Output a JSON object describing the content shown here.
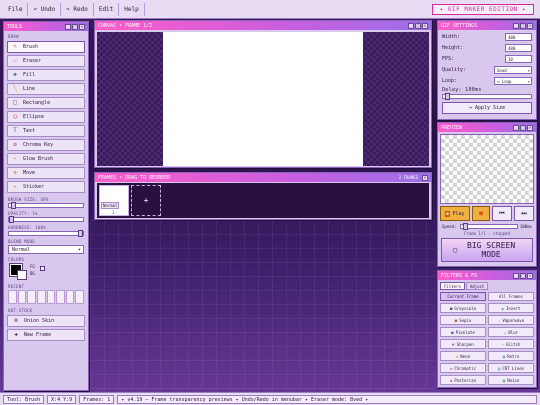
{
  "menu": {
    "file": "File",
    "undo": "↶ Undo",
    "redo": "↷ Redo",
    "edit": "Edit",
    "help": "Help",
    "brand": "✦ GIF MAKER EDITION ✦"
  },
  "tools": {
    "title": "TOOLS",
    "section": "DRAW",
    "items": [
      {
        "label": "Brush",
        "icon": "✎",
        "icon_name": "brush-icon",
        "color": "#c86a2a"
      },
      {
        "label": "Eraser",
        "icon": "▭",
        "icon_name": "eraser-icon",
        "color": "#e27aa8"
      },
      {
        "label": "Fill",
        "icon": "◆",
        "icon_name": "fill-bucket-icon",
        "color": "#3a7ad0"
      },
      {
        "label": "Line",
        "icon": "╲",
        "icon_name": "line-icon",
        "color": "#c8a02a"
      },
      {
        "label": "Rectangle",
        "icon": "□",
        "icon_name": "rectangle-icon",
        "color": "#555555"
      },
      {
        "label": "Ellipse",
        "icon": "◯",
        "icon_name": "ellipse-icon",
        "color": "#d22c2c"
      },
      {
        "label": "Text",
        "icon": "T",
        "icon_name": "text-icon",
        "color": "#2a6ad0"
      },
      {
        "label": "Chroma Key",
        "icon": "✿",
        "icon_name": "chroma-key-icon",
        "color": "#d04a9a"
      },
      {
        "label": "Glow Brush",
        "icon": "✦",
        "icon_name": "glow-brush-icon",
        "color": "#e0a020"
      },
      {
        "label": "Move",
        "icon": "✥",
        "icon_name": "move-icon",
        "color": "#d08a1a"
      },
      {
        "label": "Sticker",
        "icon": "★",
        "icon_name": "sticker-icon",
        "color": "#e0b020"
      }
    ],
    "brush_size": "BRUSH SIZE: 4PX",
    "opacity": "OPACITY: 1%",
    "hardness": "HARDNESS: 100%",
    "blend_mode_label": "BLEND MODE",
    "blend_mode": "Normal",
    "colors_label": "COLORS",
    "color_fg": "#000000",
    "color_bg": "#ffffff",
    "swatch_a": "FG",
    "swatch_b": "BG",
    "recent_label": "RECENT",
    "onion": "Onion Skin",
    "new_frame": "New Frame",
    "onion_label": "OUT-STOCK"
  },
  "canvas": {
    "title": "CANVAS • FRAME 1/2"
  },
  "frames": {
    "title": "FRAMES • DRAG TO REORDER",
    "count": "2 FRAMES",
    "frame1": "Normal",
    "frame1_num": "1",
    "add": "+"
  },
  "settings": {
    "title": "GIF SETTINGS",
    "width_label": "Width:",
    "width": "480",
    "height_label": "Height:",
    "height": "480",
    "fps_label": "FPS:",
    "fps": "10",
    "quality_label": "Quality:",
    "quality": "Good",
    "loop_label": "Loop:",
    "loop": "∞ Loop",
    "delay_label": "Delay: 100ms",
    "apply": "Apply Size"
  },
  "preview": {
    "title": "PREVIEW",
    "play": "Play",
    "stop": "■",
    "prev": "⏮",
    "next": "⏭",
    "speed_label": "Speed:",
    "speed_value": "100ms",
    "status": "Frame 1/1 · stopped",
    "big_screen": "BIG SCREEN MODE"
  },
  "filters": {
    "title": "FILTERS & FX",
    "tab_filters": "Filters",
    "tab_adjust": "Adjust",
    "current": "Current Frame",
    "all": "All Frames",
    "items": [
      {
        "label": "Grayscale",
        "icon": "■",
        "icon_name": "grayscale-icon",
        "color": "#555555"
      },
      {
        "label": "Invert",
        "icon": "◐",
        "icon_name": "invert-icon",
        "color": "#3a7ad0"
      },
      {
        "label": "Sepia",
        "icon": "■",
        "icon_name": "sepia-icon",
        "color": "#9a6a3a"
      },
      {
        "label": "Vaporwave",
        "icon": "✧",
        "icon_name": "vaporwave-icon",
        "color": "#d04aaa"
      },
      {
        "label": "Pixelate",
        "icon": "■",
        "icon_name": "pixelate-icon",
        "color": "#3a6ad0"
      },
      {
        "label": "Blur",
        "icon": "○",
        "icon_name": "blur-icon",
        "color": "#8a8a8a"
      },
      {
        "label": "Sharpen",
        "icon": "◤",
        "icon_name": "sharpen-icon",
        "color": "#5a5aa0"
      },
      {
        "label": "Glitch",
        "icon": "⚡",
        "icon_name": "glitch-icon",
        "color": "#d0a020"
      },
      {
        "label": "Neon",
        "icon": "✺",
        "icon_name": "neon-icon",
        "color": "#e0a020"
      },
      {
        "label": "Retro",
        "icon": "▣",
        "icon_name": "retro-icon",
        "color": "#3a7ad0"
      },
      {
        "label": "Chromatic",
        "icon": "◈",
        "icon_name": "chromatic-icon",
        "color": "#d04a9a"
      },
      {
        "label": "CRT Lines",
        "icon": "▤",
        "icon_name": "crt-lines-icon",
        "color": "#3a7ad0"
      },
      {
        "label": "Posterize",
        "icon": "◆",
        "icon_name": "posterize-icon",
        "color": "#d04a2a"
      },
      {
        "label": "Noise",
        "icon": "▦",
        "icon_name": "noise-icon",
        "color": "#3a9a5a"
      }
    ]
  },
  "status": {
    "tool": "Tool: Brush",
    "xy": "X:4 Y:9",
    "frames": "Frames: 1",
    "msg": "✦ v4.19 — Frame transparency previews ✦ Undo/Redo in menubar ✦ Eraser mode: Bved ✦"
  }
}
